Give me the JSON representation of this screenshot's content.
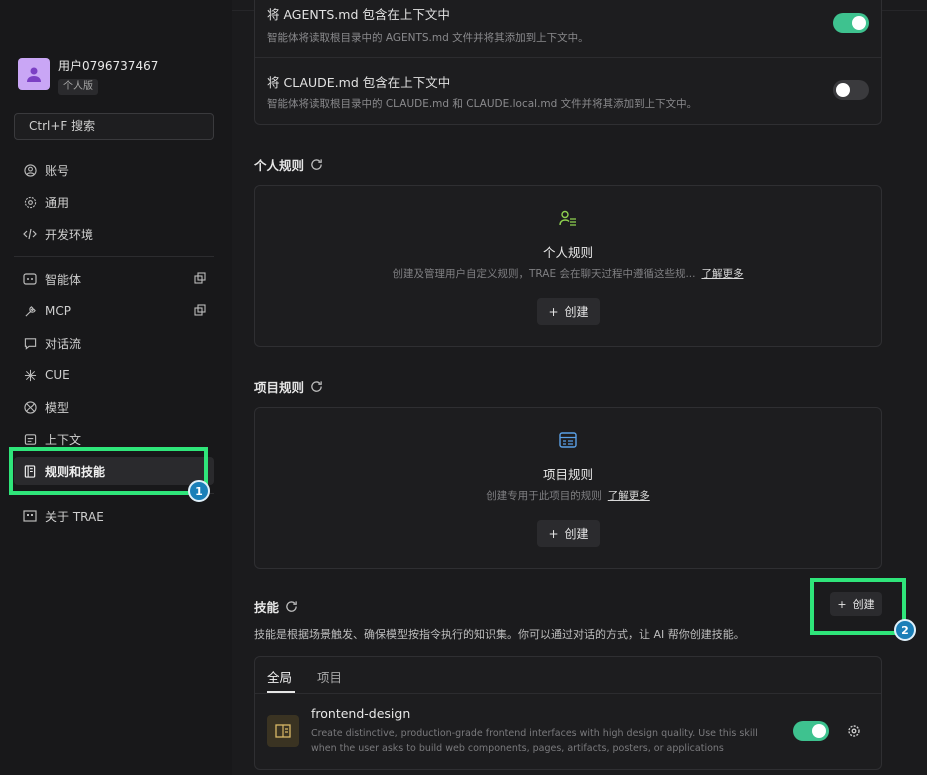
{
  "user": {
    "name": "用户0796737467",
    "plan": "个人版"
  },
  "search": {
    "label": "Ctrl+F 搜索"
  },
  "nav": {
    "account": "账号",
    "general": "通用",
    "dev_env": "开发环境",
    "agents": "智能体",
    "mcp": "MCP",
    "flow": "对话流",
    "cue": "CUE",
    "models": "模型",
    "context": "上下文",
    "rules_skills": "规则和技能",
    "about": "关于 TRAE"
  },
  "context_card": {
    "agents_title": "将 AGENTS.md 包含在上下文中",
    "agents_desc": "智能体将读取根目录中的 AGENTS.md 文件并将其添加到上下文中。",
    "agents_enabled": true,
    "claude_title": "将 CLAUDE.md 包含在上下文中",
    "claude_desc": "智能体将读取根目录中的 CLAUDE.md 和 CLAUDE.local.md 文件并将其添加到上下文中。",
    "claude_enabled": false
  },
  "personal_rules": {
    "section_title": "个人规则",
    "card_title": "个人规则",
    "desc": "创建及管理用户自定义规则，TRAE 会在聊天过程中遵循这些规...",
    "learn_more": "了解更多",
    "create": "创建"
  },
  "project_rules": {
    "section_title": "项目规则",
    "card_title": "项目规则",
    "desc": "创建专用于此项目的规则",
    "learn_more": "了解更多",
    "create": "创建"
  },
  "skills": {
    "section_title": "技能",
    "create": "创建",
    "desc": "技能是根据场景触发、确保模型按指令执行的知识集。你可以通过对话的方式，让 AI 帮你创建技能。",
    "tabs": [
      "全局",
      "项目"
    ],
    "items": [
      {
        "name": "frontend-design",
        "desc": "Create distinctive, production-grade frontend interfaces with high design quality. Use this skill when the user asks to build web components, pages, artifacts, posters, or applications (examples...",
        "enabled": true
      }
    ]
  },
  "annotations": [
    "1",
    "2"
  ],
  "colors": {
    "accent": "#3ec28f",
    "highlight": "#2fe57a",
    "badge": "#1a7fb8",
    "rule_icon_personal": "#8fd14f",
    "rule_icon_project": "#5aa0e6"
  }
}
